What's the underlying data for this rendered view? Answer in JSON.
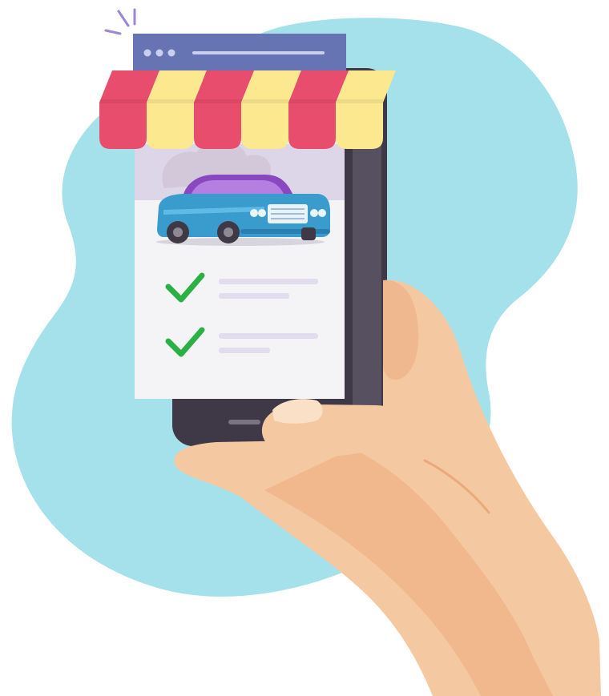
{
  "palette": {
    "background": "#ffffff",
    "blob": "#a4e1ea",
    "phone_body": "#3f3847",
    "phone_edge": "#575060",
    "screen_card": "#f4f4f6",
    "browser_bar": "#6674b4",
    "awning_red": "#e94d6d",
    "awning_yellow": "#fbe88f",
    "car_body": "#3a9ccd",
    "car_roof": "#8a48c0",
    "check_green": "#2ab043",
    "placeholder_line": "#e2dcef",
    "skin": "#f4c8a0",
    "skin_shadow": "#eeae80"
  },
  "icons": {
    "car": "car-icon",
    "check": "check-icon",
    "awning": "shop-awning-icon",
    "sparkle": "sparkle-icon"
  },
  "checklist": {
    "items": [
      {
        "checked": true
      },
      {
        "checked": true
      }
    ]
  }
}
